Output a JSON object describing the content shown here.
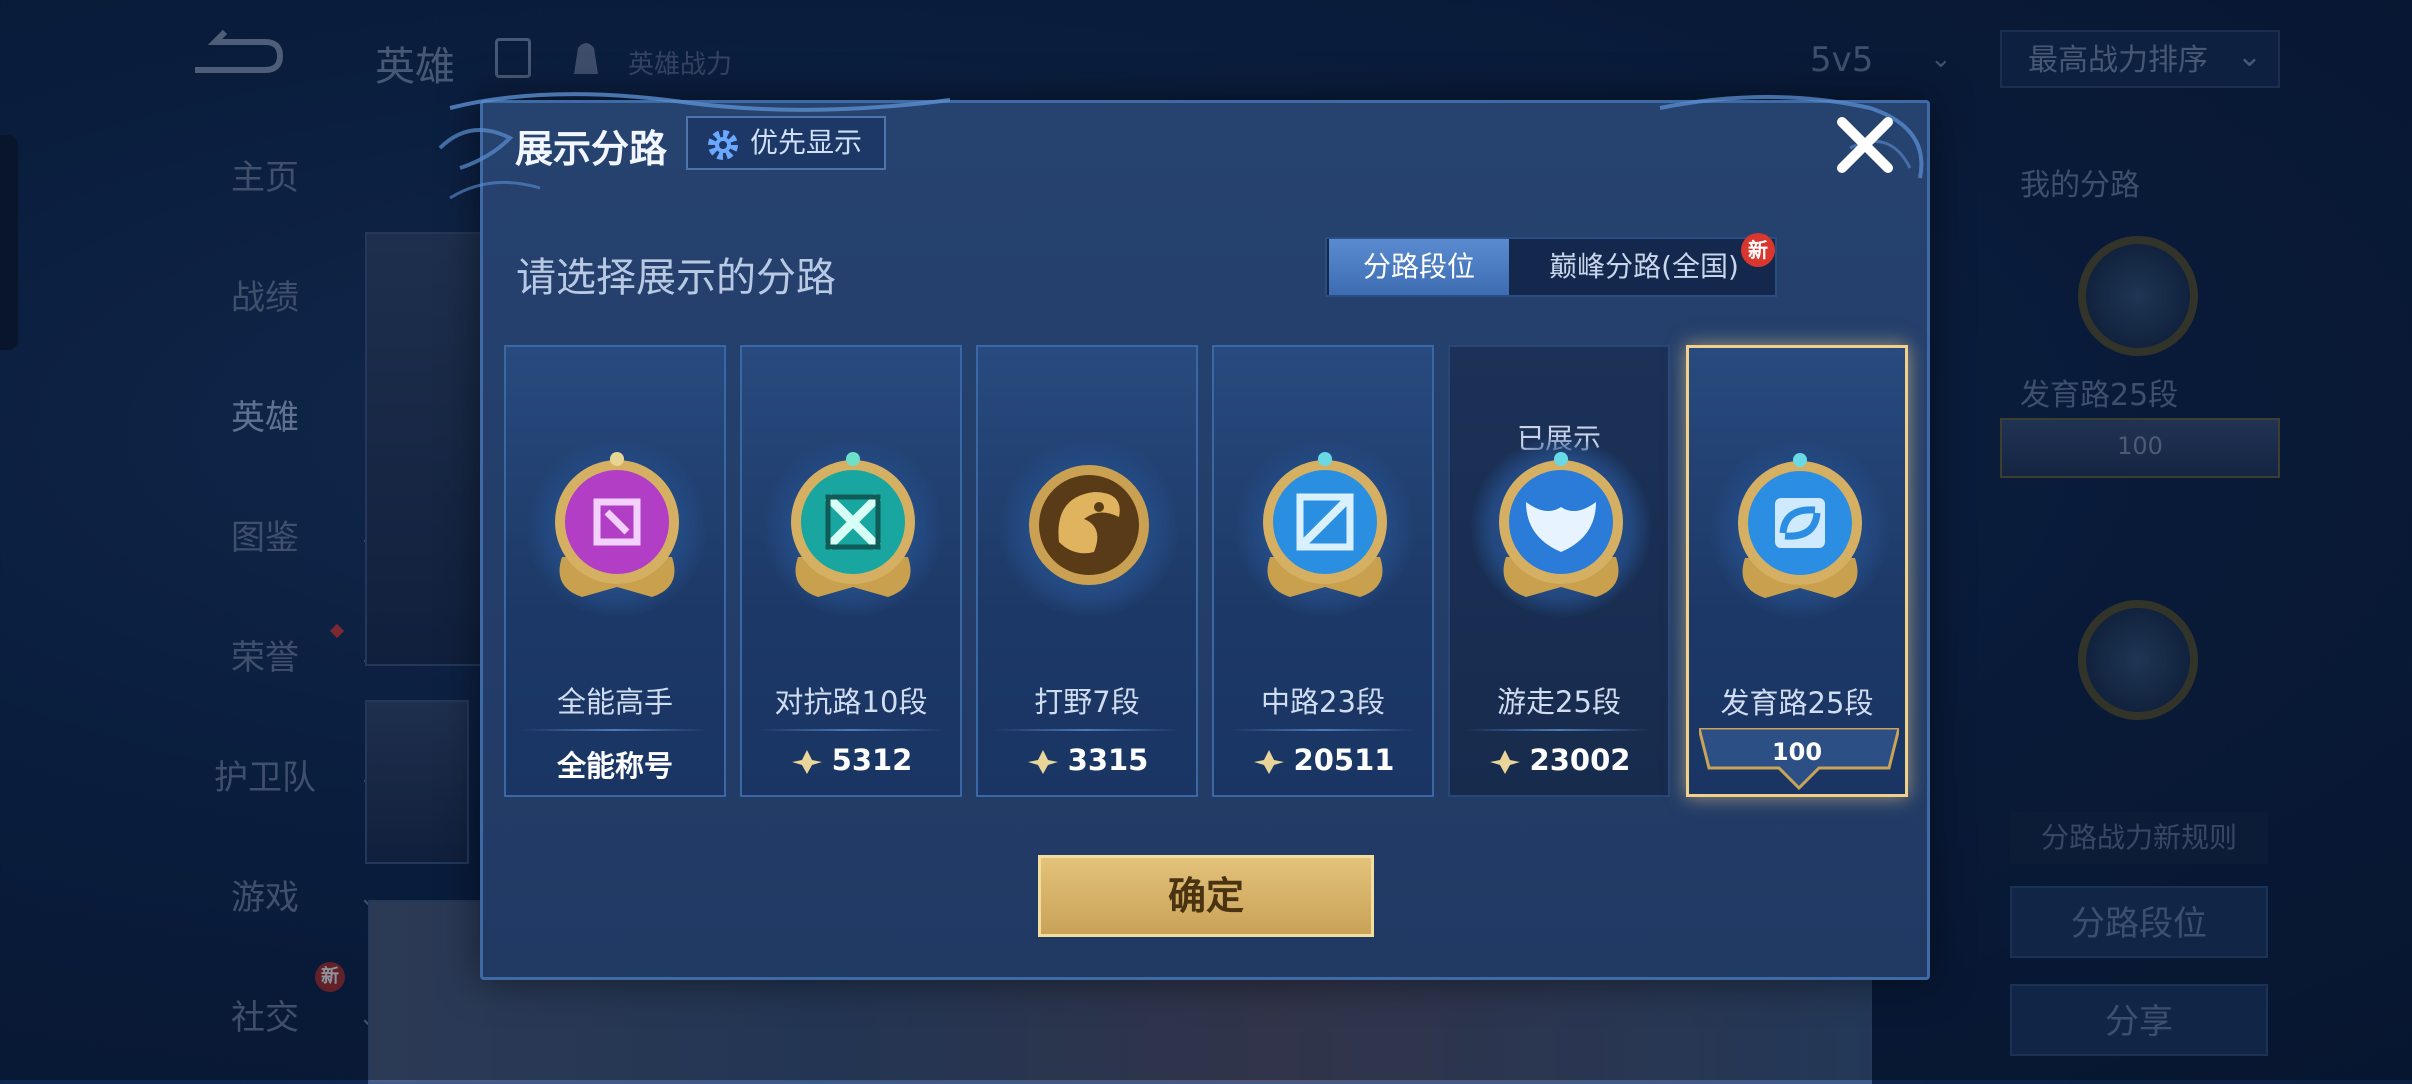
{
  "background": {
    "header": {
      "title": "英雄",
      "power_label": "英雄战力",
      "mode": "5v5",
      "sort": "最高战力排序"
    },
    "sidebar": [
      {
        "label": "主页",
        "chevron": false
      },
      {
        "label": "战绩",
        "chevron": false
      },
      {
        "label": "英雄",
        "chevron": false,
        "active": true
      },
      {
        "label": "图鉴",
        "chevron": true
      },
      {
        "label": "荣誉",
        "chevron": true
      },
      {
        "label": "护卫队",
        "chevron": true
      },
      {
        "label": "游戏",
        "chevron": true
      },
      {
        "label": "社交",
        "chevron": true,
        "new": "新"
      }
    ],
    "right_panel": {
      "title": "我的分路",
      "lane_label": "发育路25段",
      "lane_score": "100",
      "rule_label": "分路战力新规则",
      "lane_button": "分路段位",
      "share_button": "分享"
    }
  },
  "dialog": {
    "title": "展示分路",
    "priority_button": "优先显示",
    "prompt": "请选择展示的分路",
    "tabs": [
      {
        "label": "分路段位",
        "active": true
      },
      {
        "label": "巅峰分路(全国)",
        "badge": "新"
      }
    ],
    "cards": [
      {
        "name": "全能高手",
        "footer": "全能称号",
        "badge_color": "#b13ec4",
        "icon": "all-round-emblem"
      },
      {
        "name": "对抗路10段",
        "power": "5312",
        "badge_color": "#19a6a0",
        "icon": "clash-lane-emblem"
      },
      {
        "name": "打野7段",
        "power": "3315",
        "badge_color": "#c98f3a",
        "icon": "jungle-dragon-emblem"
      },
      {
        "name": "中路23段",
        "power": "20511",
        "badge_color": "#2a8fe0",
        "icon": "mid-lane-emblem"
      },
      {
        "name": "游走25段",
        "power": "23002",
        "status": "已展示",
        "badge_color": "#2b7bd8",
        "icon": "roam-wings-emblem"
      },
      {
        "name": "发育路25段",
        "score": "100",
        "badge_color": "#2b8ee3",
        "icon": "farm-lane-emblem",
        "selected": true
      }
    ],
    "confirm_button": "确定"
  }
}
